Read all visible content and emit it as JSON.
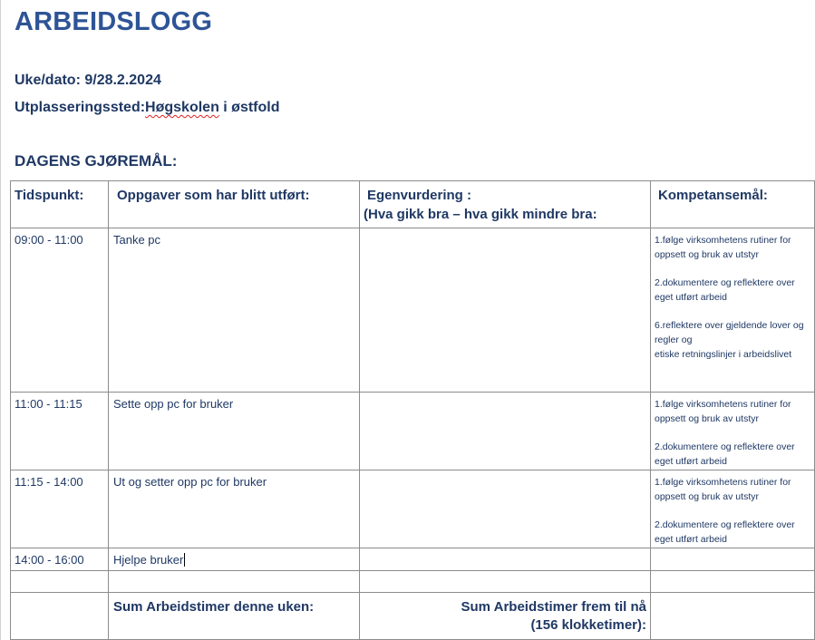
{
  "title": "ARBEIDSLOGG",
  "week_label": "Uke/dato: 9/28.2.2024",
  "location_label": "Utplasseringssted:",
  "location_value_misspelled": "Høgskolen",
  "location_value_rest": " i østfold",
  "section_title": "DAGENS GJØREMÅL:",
  "table": {
    "headers": {
      "time": "Tidspunkt:",
      "tasks": "Oppgaver som har blitt utført:",
      "eval_line1": "Egenvurdering :",
      "eval_line2": "(Hva gikk bra – hva gikk mindre bra:",
      "goals": "Kompetansemål:"
    },
    "rows": [
      {
        "time": "09:00 - 11:00",
        "task": "Tanke pc",
        "evaluation": "",
        "goals": [
          "1.følge virksomhetens rutiner for oppsett og bruk av utstyr",
          "2.dokumentere og reflektere over eget utført arbeid",
          "6.reflektere over gjeldende lover og regler og",
          "etiske retningslinjer i arbeidslivet"
        ]
      },
      {
        "time": "11:00 - 11:15",
        "task": "Sette opp pc for bruker",
        "evaluation": "",
        "goals": [
          "1.følge virksomhetens rutiner for oppsett og bruk av utstyr",
          "2.dokumentere og reflektere over eget utført arbeid"
        ]
      },
      {
        "time": "11:15 - 14:00",
        "task": "Ut og setter opp pc for bruker",
        "evaluation": "",
        "goals": [
          "1.følge virksomhetens rutiner for oppsett og bruk av utstyr",
          "2.dokumentere og reflektere over eget utført arbeid"
        ]
      },
      {
        "time": "14:00 - 16:00",
        "task": "Hjelpe bruker",
        "evaluation": "",
        "goals": []
      }
    ],
    "sum_week": "Sum Arbeidstimer denne uken:",
    "sum_total_line1": "Sum Arbeidstimer frem til nå",
    "sum_total_line2": "(156 klokketimer):"
  }
}
